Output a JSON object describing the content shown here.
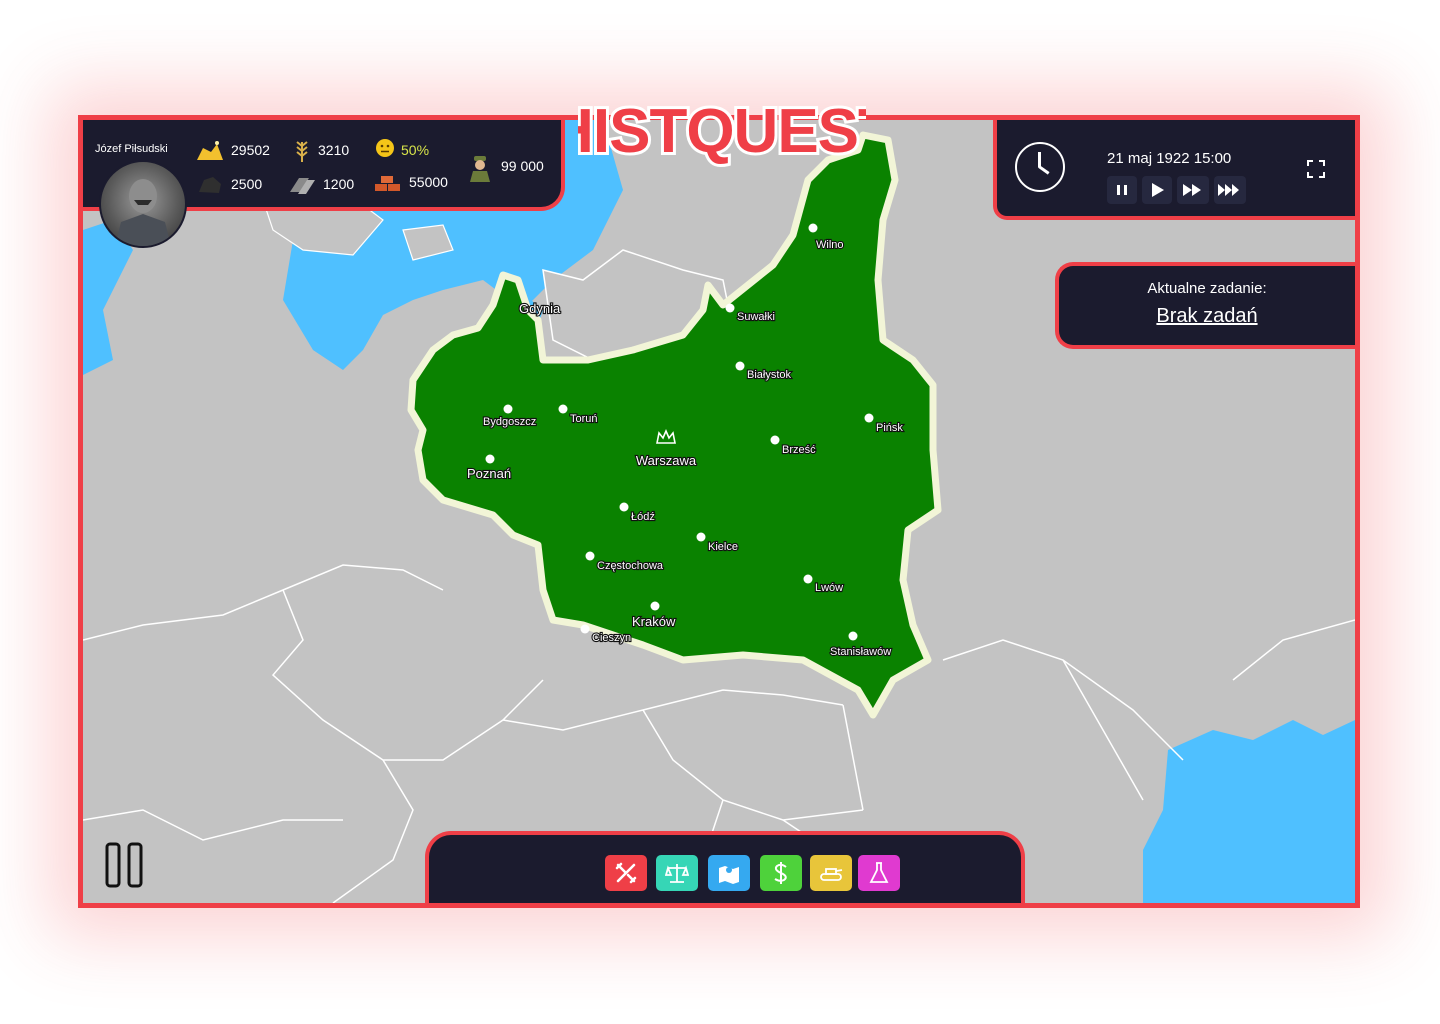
{
  "logo": {
    "text": "HISTQUEST"
  },
  "leader": {
    "name": "Józef Piłsudski"
  },
  "resources": {
    "gold": "29502",
    "wheat": "3210",
    "happiness": "50%",
    "soldiers": "99 000",
    "coal": "2500",
    "iron": "1200",
    "bricks": "55000"
  },
  "time": {
    "date": "21 maj 1922 15:00"
  },
  "task": {
    "title": "Aktualne zadanie:",
    "value": "Brak zadań"
  },
  "capital": {
    "name": "Warszawa"
  },
  "cities": [
    {
      "name": "Wilno"
    },
    {
      "name": "Gdynia"
    },
    {
      "name": "Suwałki"
    },
    {
      "name": "Białystok"
    },
    {
      "name": "Bydgoszcz"
    },
    {
      "name": "Toruń"
    },
    {
      "name": "Pińsk"
    },
    {
      "name": "Brześć"
    },
    {
      "name": "Poznań"
    },
    {
      "name": "Łódź"
    },
    {
      "name": "Kielce"
    },
    {
      "name": "Częstochowa"
    },
    {
      "name": "Lwów"
    },
    {
      "name": "Kraków"
    },
    {
      "name": "Cieszyn"
    },
    {
      "name": "Stanisławów"
    }
  ],
  "actions": [
    {
      "icon": "tools-icon",
      "color": "#ef3f47"
    },
    {
      "icon": "scales-icon",
      "color": "#36d6b6"
    },
    {
      "icon": "map-icon",
      "color": "#35a9f0"
    },
    {
      "icon": "dollar-icon",
      "color": "#4ed23b"
    },
    {
      "icon": "tank-icon",
      "color": "#e8c53a"
    },
    {
      "icon": "flask-icon",
      "color": "#e03ad0"
    }
  ],
  "colors": {
    "accent": "#ef3f47",
    "panel": "#1b1b2e",
    "poland": "#0a8200",
    "sea": "#4fc0ff",
    "land": "#c3c3c3"
  }
}
